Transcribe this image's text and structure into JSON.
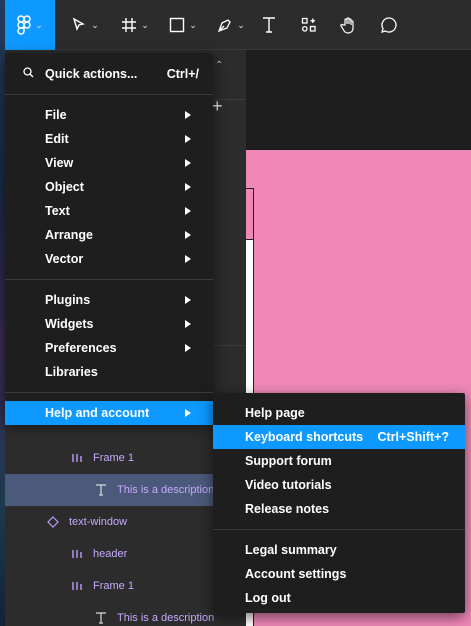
{
  "toolbar": {
    "main_menu_icon": "figma-logo-icon",
    "tools": [
      {
        "name": "move-tool",
        "icon": "cursor-arrow-icon"
      },
      {
        "name": "frame-tool",
        "icon": "hash-frame-icon"
      },
      {
        "name": "shape-tool",
        "icon": "rectangle-icon"
      },
      {
        "name": "pen-tool",
        "icon": "pen-icon"
      },
      {
        "name": "text-tool",
        "icon": "text-T-icon"
      },
      {
        "name": "resources-tool",
        "icon": "components-grid-icon"
      },
      {
        "name": "hand-tool",
        "icon": "hand-icon"
      },
      {
        "name": "comment-tool",
        "icon": "speech-bubble-icon"
      }
    ]
  },
  "menu": {
    "quick_actions": {
      "label": "Quick actions...",
      "shortcut": "Ctrl+/"
    },
    "group1": [
      {
        "label": "File"
      },
      {
        "label": "Edit"
      },
      {
        "label": "View"
      },
      {
        "label": "Object"
      },
      {
        "label": "Text"
      },
      {
        "label": "Arrange"
      },
      {
        "label": "Vector"
      }
    ],
    "group2": [
      {
        "label": "Plugins"
      },
      {
        "label": "Widgets"
      },
      {
        "label": "Preferences"
      },
      {
        "label": "Libraries"
      }
    ],
    "help": {
      "label": "Help and account"
    }
  },
  "submenu": {
    "items": [
      {
        "label": "Help page"
      },
      {
        "label": "Keyboard shortcuts",
        "shortcut": "Ctrl+Shift+?"
      },
      {
        "label": "Support forum"
      },
      {
        "label": "Video tutorials"
      },
      {
        "label": "Release notes"
      }
    ],
    "items2": [
      {
        "label": "Legal summary"
      },
      {
        "label": "Account settings"
      },
      {
        "label": "Log out"
      }
    ]
  },
  "layers": [
    {
      "label": "Frame 1",
      "type": "frame"
    },
    {
      "label": "This is a description",
      "type": "text"
    },
    {
      "label": "text-window",
      "type": "component"
    },
    {
      "label": "header",
      "type": "frame"
    },
    {
      "label": "Frame 1",
      "type": "frame"
    },
    {
      "label": "This is a description",
      "type": "text"
    }
  ],
  "colors": {
    "accent": "#0d99ff",
    "menu_bg": "#1e1e1e",
    "canvas_frame": "#f088b7",
    "layer_purple": "#c7a8ff"
  }
}
